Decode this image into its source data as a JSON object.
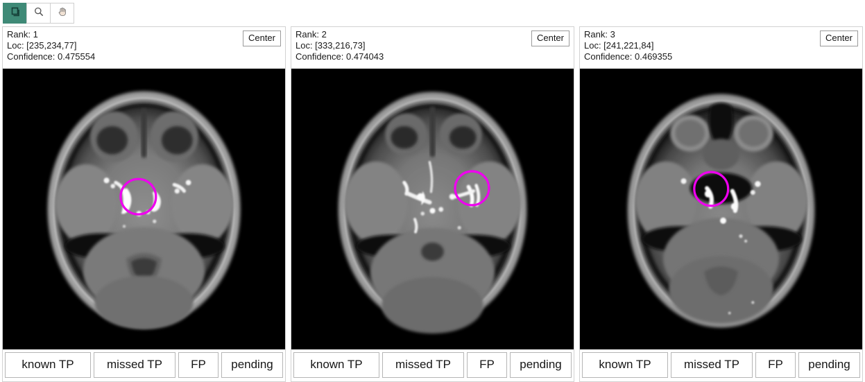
{
  "toolbar": {
    "buttons": [
      {
        "name": "window-level-tool",
        "icon": "layers-icon",
        "active": true,
        "label": ""
      },
      {
        "name": "zoom-tool",
        "icon": "magnifier-icon",
        "active": false,
        "label": ""
      },
      {
        "name": "pan-tool",
        "icon": "hand-icon",
        "active": false,
        "label": ""
      }
    ]
  },
  "colors": {
    "marker": "#ee00ee",
    "toolbar_active": "#3f8a77",
    "toolbar_icon_dark": "#1d5147",
    "panel_border": "#d2d2d2",
    "button_border": "#b5b5b5",
    "image_background": "#000000"
  },
  "center_button_label": "Center",
  "classification_buttons": [
    {
      "name": "known-tp-button",
      "label": "known TP"
    },
    {
      "name": "missed-tp-button",
      "label": "missed TP"
    },
    {
      "name": "fp-button",
      "label": "FP"
    },
    {
      "name": "pending-button",
      "label": "pending"
    }
  ],
  "panels": [
    {
      "rank_line": "Rank: 1",
      "loc_line": "Loc: [235,234,77]",
      "confidence_line": "Confidence: 0.475554",
      "rank": 1,
      "loc": [
        235,
        234,
        77
      ],
      "confidence": 0.475554,
      "marker": {
        "cx_pct": 48.0,
        "cy_pct": 45.5,
        "r_pct": 6.2
      },
      "modality": "axial brain MR angiography slice at skull-base level"
    },
    {
      "rank_line": "Rank: 2",
      "loc_line": "Loc: [333,216,73]",
      "confidence_line": "Confidence: 0.474043",
      "rank": 2,
      "loc": [
        333,
        216,
        73
      ],
      "confidence": 0.474043,
      "marker": {
        "cx_pct": 65.5,
        "cy_pct": 42.5,
        "r_pct": 5.9
      },
      "modality": "axial brain MR angiography slice at skull-base level"
    },
    {
      "rank_line": "Rank: 3",
      "loc_line": "Loc: [241,221,84]",
      "confidence_line": "Confidence: 0.469355",
      "rank": 3,
      "loc": [
        241,
        221,
        84
      ],
      "confidence": 0.469355,
      "marker": {
        "cx_pct": 46.5,
        "cy_pct": 42.8,
        "r_pct": 6.0
      },
      "modality": "axial brain MR angiography slice showing orbits"
    }
  ]
}
